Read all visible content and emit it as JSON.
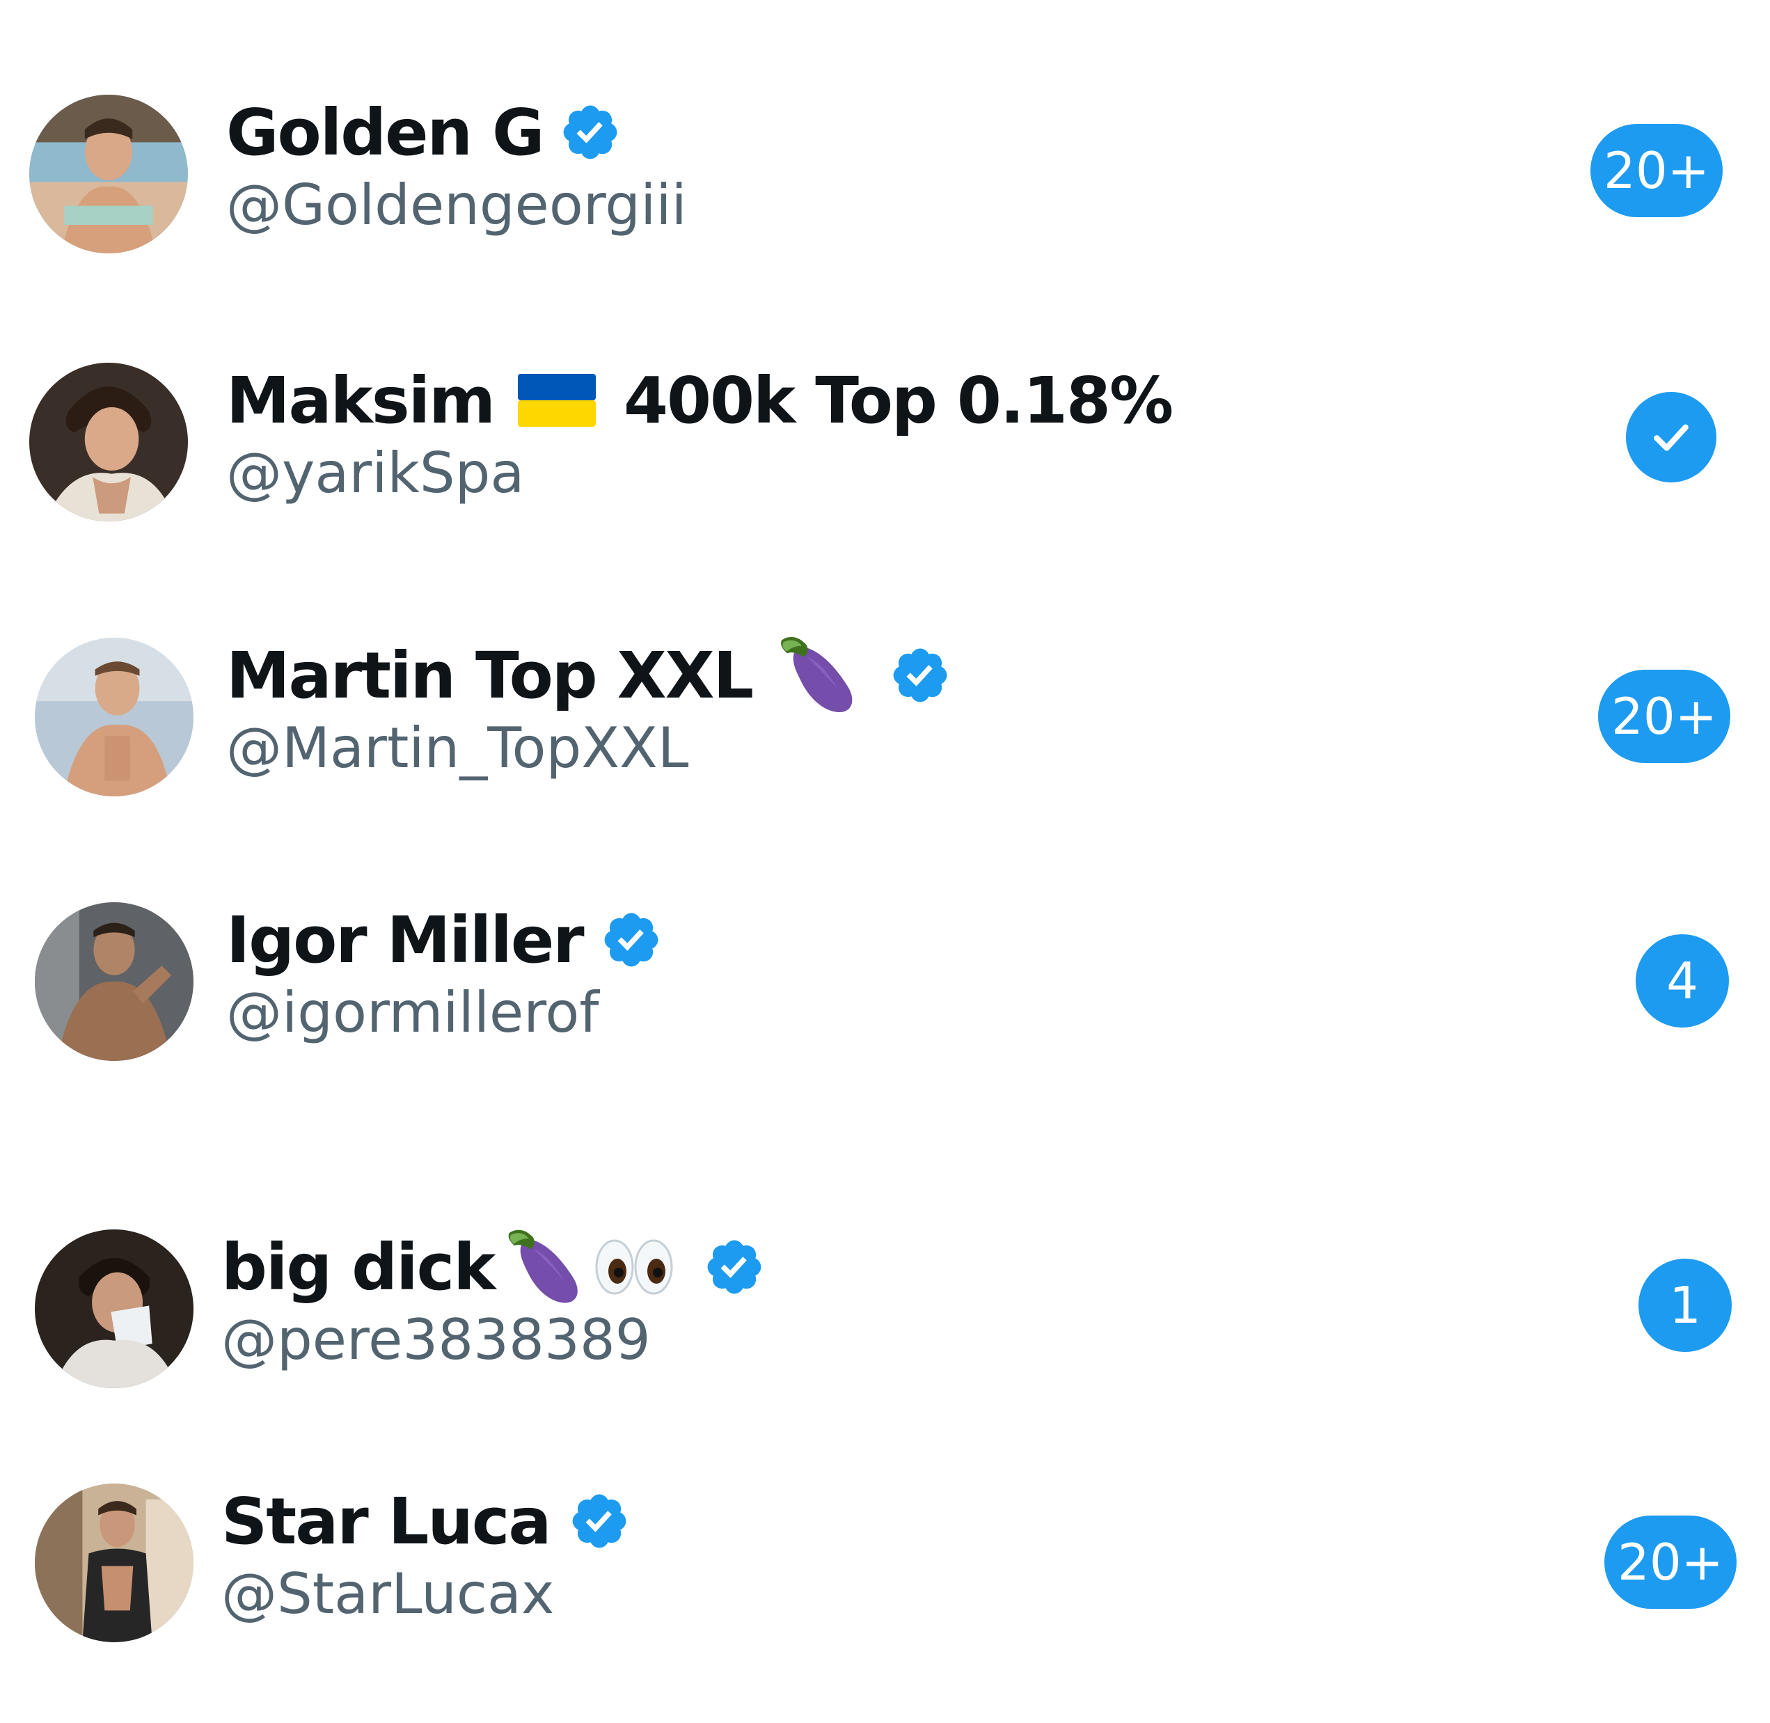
{
  "accounts": [
    {
      "name": "Golden G",
      "handle": "@Goldengeorgiii",
      "verified": true,
      "emojis": [],
      "badge": "20+"
    },
    {
      "name": "Maksim",
      "name_suffix": "400k Top 0.18%",
      "handle": "@yarikSpa",
      "verified": false,
      "emojis": [
        "flag-ukraine"
      ],
      "badge": "check"
    },
    {
      "name": "Martin Top XXL",
      "handle": "@Martin_TopXXL",
      "verified": true,
      "emojis": [
        "eggplant"
      ],
      "badge": "20+"
    },
    {
      "name": "Igor Miller",
      "handle": "@igormillerof",
      "verified": true,
      "emojis": [],
      "badge": "4"
    },
    {
      "name": "big dick",
      "handle": "@pere3838389",
      "verified": true,
      "emojis": [
        "eggplant",
        "eyes"
      ],
      "badge": "1"
    },
    {
      "name": "Star Luca",
      "handle": "@StarLucax",
      "verified": true,
      "emojis": [],
      "badge": "20+"
    }
  ],
  "colors": {
    "accent": "#1d9bf0",
    "name_text": "#0f1419",
    "handle_text": "#536471",
    "background": "#ffffff"
  }
}
